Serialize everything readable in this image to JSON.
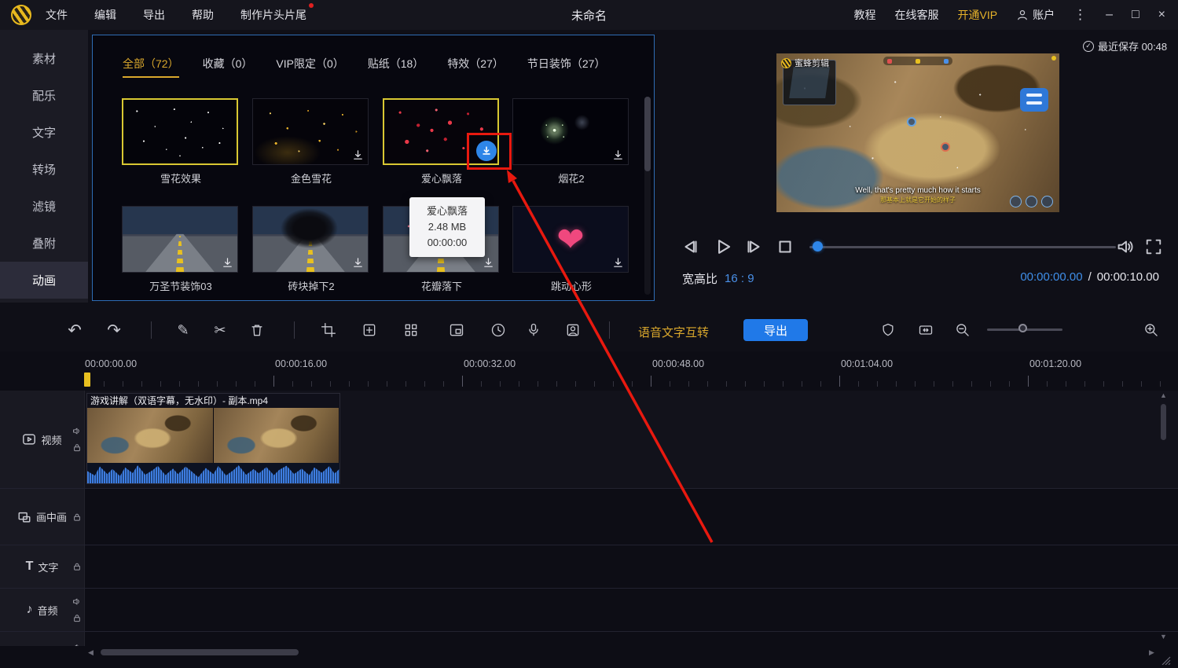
{
  "app": {
    "title": "未命名"
  },
  "titlebar": {
    "menus": [
      {
        "label": "文件"
      },
      {
        "label": "编辑"
      },
      {
        "label": "导出"
      },
      {
        "label": "帮助"
      },
      {
        "label": "制作片头片尾"
      }
    ],
    "tutorial": "教程",
    "support": "在线客服",
    "vip": "开通VIP",
    "account": "账户"
  },
  "sidebar": {
    "items": [
      {
        "label": "素材"
      },
      {
        "label": "配乐"
      },
      {
        "label": "文字"
      },
      {
        "label": "转场"
      },
      {
        "label": "滤镜"
      },
      {
        "label": "叠附"
      },
      {
        "label": "动画"
      }
    ]
  },
  "library": {
    "tabs": [
      {
        "label": "全部（72）"
      },
      {
        "label": "收藏（0）"
      },
      {
        "label": "VIP限定（0）"
      },
      {
        "label": "贴纸（18）"
      },
      {
        "label": "特效（27）"
      },
      {
        "label": "节日装饰（27）"
      }
    ],
    "items": [
      {
        "name": "雪花效果"
      },
      {
        "name": "金色雪花"
      },
      {
        "name": "爱心飘落"
      },
      {
        "name": "烟花2"
      },
      {
        "name": "万圣节装饰03"
      },
      {
        "name": "砖块掉下2"
      },
      {
        "name": "花瓣落下"
      },
      {
        "name": "跳动心形"
      }
    ],
    "tooltip": {
      "name": "爱心飘落",
      "size": "2.48 MB",
      "duration": "00:00:00"
    }
  },
  "preview": {
    "watermark": "蜜蜂剪辑",
    "saved": "最近保存 00:48",
    "caption_en": "Well, that's pretty much how it starts",
    "caption_cn": "那基本上就是它开始的样子",
    "aspect_label": "宽高比",
    "aspect_value": "16 : 9",
    "time_current": "00:00:00.00",
    "time_sep": "/",
    "time_total": "00:00:10.00"
  },
  "toolbar": {
    "speech_text": "语音文字互转",
    "export_label": "导出"
  },
  "timeline": {
    "ruler_labels": [
      "00:00:00.00",
      "00:00:16.00",
      "00:00:32.00",
      "00:00:48.00",
      "00:01:04.00",
      "00:01:20.00"
    ],
    "clip_title": "游戏讲解（双语字幕，无水印）- 副本.mp4",
    "tracks": [
      {
        "label": "视频"
      },
      {
        "label": "画中画"
      },
      {
        "label": "文字"
      },
      {
        "label": "音频"
      }
    ]
  },
  "icons": {
    "undo": "↶",
    "redo": "↷",
    "pencil": "✎",
    "scissors": "✂",
    "minimize": "–",
    "maximize": "□",
    "close": "×",
    "kebab": "⋮",
    "check": "✓",
    "note": "♪",
    "heart": "❤",
    "text_tool": "T",
    "up_arrow": "▲",
    "down_arrow": "▼",
    "left_arrow": "◀",
    "right_arrow": "▶"
  },
  "colors": {
    "accent_blue": "#2079e8",
    "accent_yellow": "#d9a72c",
    "annotation_red": "#e8190f"
  }
}
